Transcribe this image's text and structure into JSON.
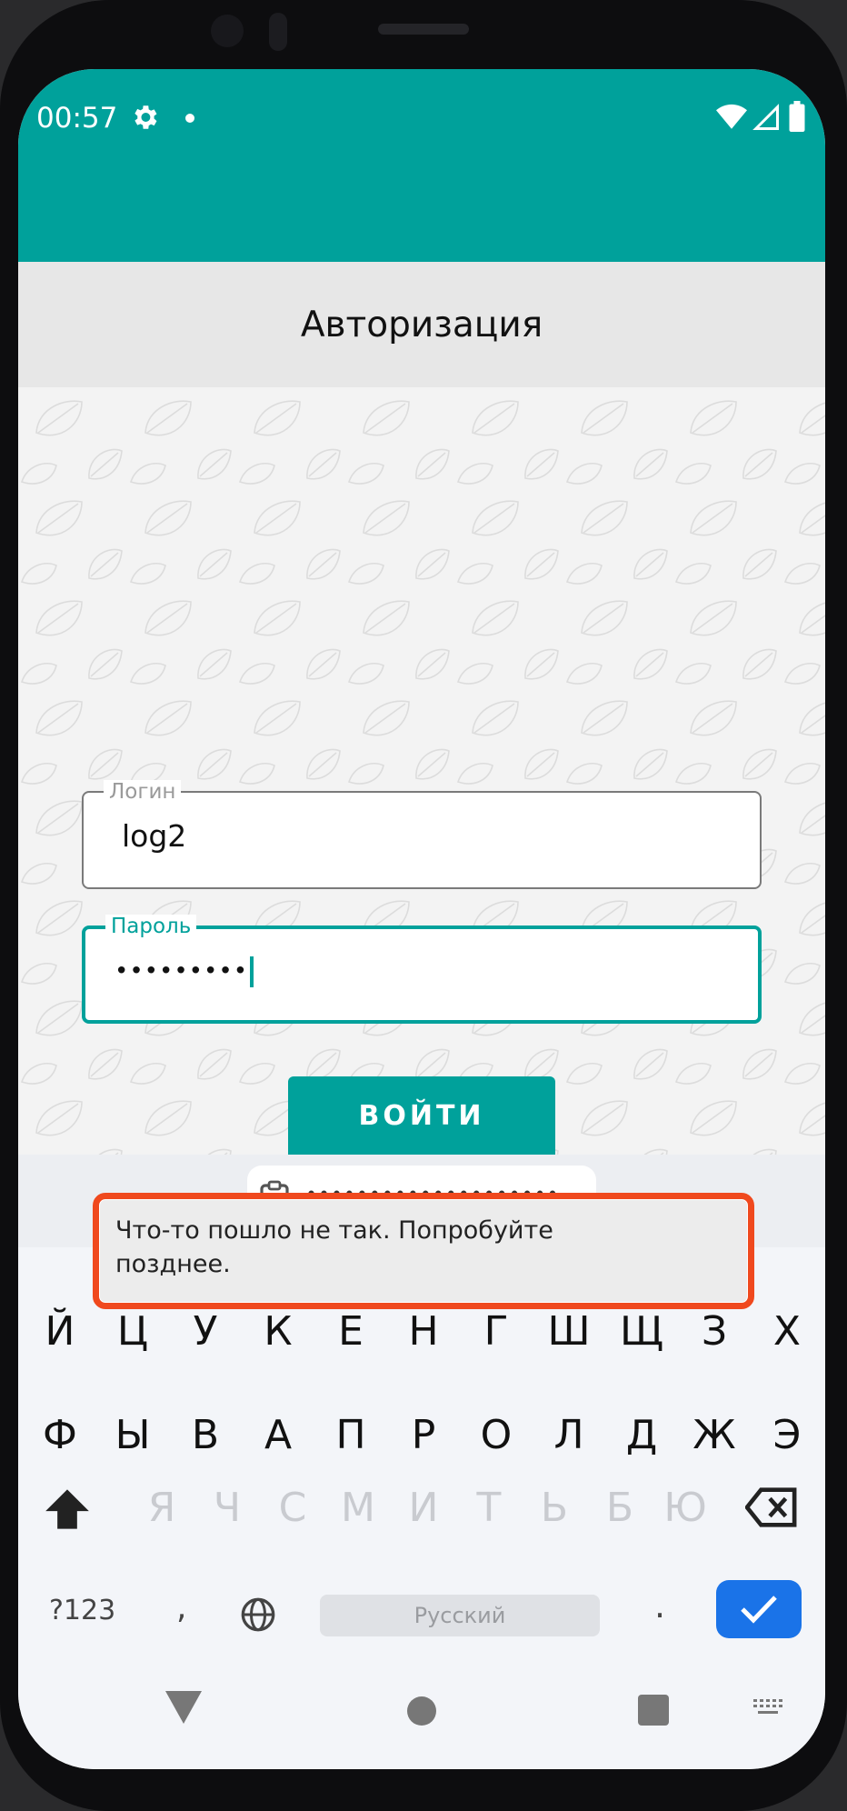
{
  "status_bar": {
    "time": "00:57",
    "icons": [
      "settings-gear-icon",
      "notification-dot",
      "wifi-icon",
      "cellular-signal-icon",
      "battery-icon"
    ],
    "color": "#00a19b"
  },
  "app": {
    "title": "Авторизация",
    "login_field": {
      "label": "Логин",
      "value": "log2"
    },
    "password_field": {
      "label": "Пароль",
      "value": "•••••••••"
    },
    "login_button": "ВОЙТИ",
    "accent_color": "#00a19b"
  },
  "keyboard": {
    "clipboard_suggestion": "••••••••••••••••••••",
    "row1": [
      "Й",
      "Ц",
      "У",
      "К",
      "Е",
      "Н",
      "Г",
      "Ш",
      "Щ",
      "З",
      "Х"
    ],
    "row2": [
      "Ф",
      "Ы",
      "В",
      "А",
      "П",
      "Р",
      "О",
      "Л",
      "Д",
      "Ж",
      "Э"
    ],
    "row3": [
      "Я",
      "Ч",
      "С",
      "М",
      "И",
      "Т",
      "Ь",
      "Б",
      "Ю"
    ],
    "symbols_key": "?123",
    "comma_key": ",",
    "space_label": "Русский",
    "period_key": ".",
    "enter_color": "#1a73e8"
  },
  "toast": {
    "message": "Что-то пошло не так. Попробуйте позднее.",
    "highlight_color": "#f0491e"
  },
  "nav_bar": {
    "buttons": [
      "back-icon",
      "home-icon",
      "recents-icon",
      "keyboard-switch-icon"
    ]
  }
}
